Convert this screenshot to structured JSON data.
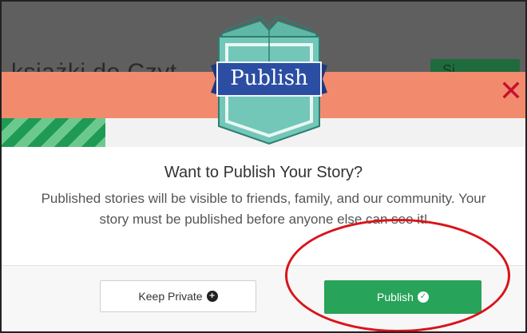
{
  "background": {
    "title_fragment": "ksiażki do Czyt",
    "button_fragment": "Si"
  },
  "logo": {
    "label": "Publish",
    "icon": "open-book-icon"
  },
  "close": {
    "glyph": "✕",
    "icon": "close-icon"
  },
  "modal": {
    "heading": "Want to Publish Your Story?",
    "description": "Published stories will be visible to friends, family, and our community. Your story must be published before anyone else can see it!"
  },
  "buttons": {
    "keep_private": {
      "label": "Keep Private",
      "icon": "plus-circle-icon",
      "glyph": "+"
    },
    "publish": {
      "label": "Publish",
      "icon": "check-circle-icon",
      "glyph": "✓"
    }
  },
  "colors": {
    "banner": "#f28b6e",
    "close": "#c8102e",
    "publish_green": "#27a35a",
    "annotation_red": "#d9141a",
    "logo_teal": "#72c7b8",
    "logo_ribbon": "#2b4ea3"
  }
}
